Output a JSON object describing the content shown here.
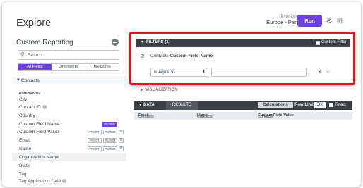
{
  "header": {
    "title": "Explore",
    "timezone_label": "Time Zone",
    "timezone_value": "Europe - Paris",
    "run_label": "Run",
    "gear_icon": "gear-icon",
    "grid_icon": "grid-icon"
  },
  "sidebar": {
    "title": "Custom Reporting",
    "search_placeholder": "Search",
    "tabs": [
      "All Fields",
      "Dimensions",
      "Measures"
    ],
    "view_name": "Contacts",
    "group_label": "DIMENSIONS",
    "fields": [
      {
        "name": "City"
      },
      {
        "name": "Contact ID"
      },
      {
        "name": "Country"
      },
      {
        "name": "Custom Field Name",
        "filter": "FILTER"
      },
      {
        "name": "Custom Field Value",
        "pivot": "PIVOT",
        "filter": "FILTER"
      },
      {
        "name": "Email",
        "pivot": "PIVOT",
        "filter": "FILTER"
      },
      {
        "name": "Name",
        "pivot": "PIVOT",
        "filter": "FILTER"
      },
      {
        "name": "Organization Name"
      },
      {
        "name": "State"
      },
      {
        "name": "Tag"
      },
      {
        "name": "Tag Application Date"
      }
    ]
  },
  "filters": {
    "header": "FILTERS (1)",
    "custom_filter_label": "Custom Filter",
    "field_view": "Contacts",
    "field_name": "Custom Field Name",
    "operator": "is equal to",
    "value": ""
  },
  "visualization": {
    "label": "VISUALIZATION"
  },
  "data": {
    "label": "DATA",
    "results_tab": "RESULTS",
    "calculations": "Calculations",
    "row_limit_label": "Row Limit",
    "row_limit_value": "500",
    "totals_label": "Totals",
    "columns": [
      {
        "view": "Contacts",
        "field": "Email"
      },
      {
        "view": "Contacts",
        "field": "Name"
      },
      {
        "view": "Contacts",
        "field": "Custom Field Value"
      }
    ]
  },
  "colors": {
    "accent": "#6c43e0",
    "highlight": "#e0151b",
    "dark_bar": "#3a3e43"
  }
}
